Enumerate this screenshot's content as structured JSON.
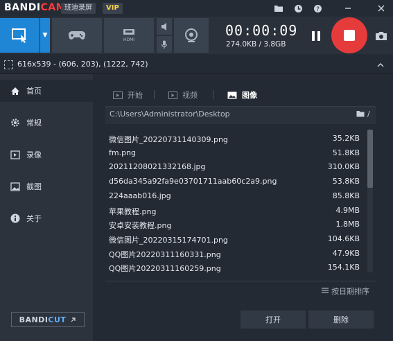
{
  "titlebar": {
    "brand_a": "BANDI",
    "brand_b": "CAM",
    "edition": "班迪录屏",
    "vip": "VIP"
  },
  "toolbar": {
    "timer": "00:00:09",
    "size": "274.0KB / 3.8GB"
  },
  "region": {
    "text": "616x539 - (606, 203), (1222, 742)"
  },
  "sidebar": {
    "items": [
      {
        "label": "首页",
        "icon": "home-icon"
      },
      {
        "label": "常规",
        "icon": "gear-icon"
      },
      {
        "label": "录像",
        "icon": "video-icon"
      },
      {
        "label": "截图",
        "icon": "image-icon"
      },
      {
        "label": "关于",
        "icon": "info-icon"
      }
    ],
    "bandicut_a": "BANDI",
    "bandicut_b": "CUT"
  },
  "tabs": [
    {
      "label": "开始"
    },
    {
      "label": "视频"
    },
    {
      "label": "图像"
    }
  ],
  "path": "C:\\Users\\Administrator\\Desktop",
  "files": [
    {
      "name": "微信图片_20220731140309.png",
      "size": "35.2KB"
    },
    {
      "name": "fm.png",
      "size": "51.8KB"
    },
    {
      "name": "20211208021332168.jpg",
      "size": "310.0KB"
    },
    {
      "name": "d56da345a92fa9e03701711aab60c2a9.png",
      "size": "53.8KB"
    },
    {
      "name": "224aaab016.jpg",
      "size": "85.8KB"
    },
    {
      "name": "苹果教程.png",
      "size": "4.9MB"
    },
    {
      "name": "安卓安装教程.png",
      "size": "1.8MB"
    },
    {
      "name": "微信图片_20220315174701.png",
      "size": "104.6KB"
    },
    {
      "name": "QQ图片20220311160331.png",
      "size": "47.9KB"
    },
    {
      "name": "QQ图片20220311160259.png",
      "size": "154.1KB"
    }
  ],
  "sort_label": "按日期排序",
  "buttons": {
    "open": "打开",
    "delete": "删除"
  },
  "colors": {
    "accent": "#1f86d6",
    "record": "#e63b3b",
    "cam_red": "#ff3b3b",
    "vip": "#ffd34d"
  }
}
